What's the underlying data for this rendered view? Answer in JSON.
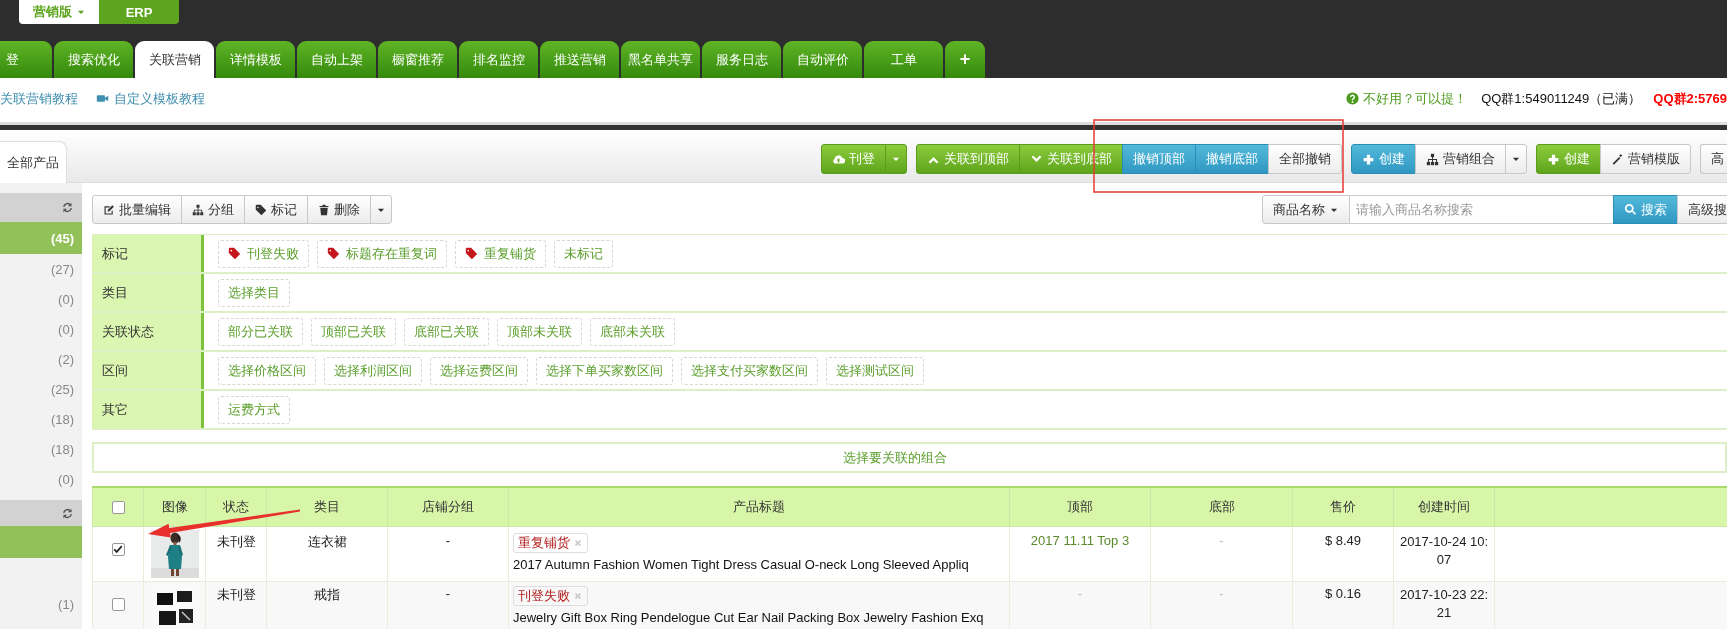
{
  "edition_switch": {
    "items": [
      {
        "label": "营销版",
        "selected": true
      },
      {
        "label": "ERP",
        "selected": false
      }
    ]
  },
  "main_tabs": [
    {
      "label": "登",
      "selected": false,
      "kind": "text"
    },
    {
      "label": "搜索优化",
      "selected": false,
      "kind": "text"
    },
    {
      "label": "关联营销",
      "selected": true,
      "kind": "text"
    },
    {
      "label": "详情模板",
      "selected": false,
      "kind": "text"
    },
    {
      "label": "自动上架",
      "selected": false,
      "kind": "text"
    },
    {
      "label": "橱窗推荐",
      "selected": false,
      "kind": "text"
    },
    {
      "label": "排名监控",
      "selected": false,
      "kind": "text"
    },
    {
      "label": "推送营销",
      "selected": false,
      "kind": "text"
    },
    {
      "label": "黑名单共享",
      "selected": false,
      "kind": "text"
    },
    {
      "label": "服务日志",
      "selected": false,
      "kind": "text"
    },
    {
      "label": "自动评价",
      "selected": false,
      "kind": "text"
    },
    {
      "label": "工单",
      "selected": false,
      "kind": "text"
    },
    {
      "label": "+",
      "selected": false,
      "kind": "add"
    }
  ],
  "links": [
    {
      "label": "关联营销教程",
      "kind": "text"
    },
    {
      "label": "自定义模板教程",
      "kind": "video"
    }
  ],
  "feedback": {
    "prompt": "不好用？可以提！",
    "qq_group_1": "QQ群1:549011249（已满）",
    "qq_group_2": "QQ群2:5769"
  },
  "panel_tab": {
    "label": "全部产品"
  },
  "actions": [
    {
      "buttons": [
        {
          "label": "刊登",
          "kind": "publish"
        },
        {
          "kind": "publish_menu"
        }
      ]
    },
    {
      "buttons": [
        {
          "label": "关联到顶部",
          "kind": "link_top"
        },
        {
          "label": "关联到底部",
          "kind": "link_bottom"
        },
        {
          "label": "撤销顶部",
          "kind": "undo"
        },
        {
          "label": "撤销底部",
          "kind": "undo"
        },
        {
          "label": "全部撤销",
          "kind": "plain"
        }
      ]
    },
    {
      "buttons": [
        {
          "label": "创建",
          "kind": "create_combo"
        },
        {
          "label": "营销组合",
          "kind": "combo"
        },
        {
          "kind": "menu"
        }
      ]
    },
    {
      "buttons": [
        {
          "label": "创建",
          "kind": "create_template"
        },
        {
          "label": "营销模版",
          "kind": "template"
        }
      ]
    },
    {
      "buttons": [
        {
          "label": "高",
          "kind": "plain"
        }
      ]
    }
  ],
  "sidebar": {
    "groups": [
      {
        "items": [
          {
            "count": "(45)",
            "selected": true
          },
          {
            "count": "(27)",
            "selected": false
          },
          {
            "count": "(0)",
            "selected": false
          },
          {
            "count": "(0)",
            "selected": false
          },
          {
            "count": "(2)",
            "selected": false
          },
          {
            "count": "(25)",
            "selected": false
          },
          {
            "count": "(18)",
            "selected": false
          },
          {
            "count": "(18)",
            "selected": false
          },
          {
            "count": "(0)",
            "selected": false
          }
        ]
      },
      {
        "items": [
          {
            "selected": true
          },
          {
            "count": "(1)",
            "selected": false
          }
        ]
      }
    ]
  },
  "batch_actions": [
    {
      "label": "批量编辑",
      "kind": "edit"
    },
    {
      "label": "分组",
      "kind": "group"
    },
    {
      "label": "标记",
      "kind": "mark"
    },
    {
      "label": "删除",
      "kind": "delete"
    },
    {
      "kind": "menu"
    }
  ],
  "search": {
    "field_menu": "商品名称",
    "placeholder": "请输入商品名称搜索",
    "button": "搜索",
    "advanced": "高级搜"
  },
  "filters": [
    {
      "label": "标记",
      "options": [
        {
          "label": "刊登失败",
          "tag": true
        },
        {
          "label": "标题存在重复词",
          "tag": true
        },
        {
          "label": "重复铺货",
          "tag": true
        },
        {
          "label": "未标记",
          "tag": false
        }
      ]
    },
    {
      "label": "类目",
      "options": [
        {
          "label": "选择类目",
          "tag": false
        }
      ]
    },
    {
      "label": "关联状态",
      "options": [
        {
          "label": "部分已关联",
          "tag": false
        },
        {
          "label": "顶部已关联",
          "tag": false
        },
        {
          "label": "底部已关联",
          "tag": false
        },
        {
          "label": "顶部未关联",
          "tag": false
        },
        {
          "label": "底部未关联",
          "tag": false
        }
      ]
    },
    {
      "label": "区间",
      "options": [
        {
          "label": "选择价格区间",
          "tag": false
        },
        {
          "label": "选择利润区间",
          "tag": false
        },
        {
          "label": "选择运费区间",
          "tag": false
        },
        {
          "label": "选择下单买家数区间",
          "tag": false
        },
        {
          "label": "选择支付买家数区间",
          "tag": false
        },
        {
          "label": "选择测试区间",
          "tag": false
        }
      ]
    },
    {
      "label": "其它",
      "options": [
        {
          "label": "运费方式",
          "tag": false
        }
      ]
    }
  ],
  "combo_bar": {
    "prompt": "选择要关联的组合"
  },
  "table": {
    "select_all": {
      "checked": false
    },
    "columns": [
      "图像",
      "状态",
      "类目",
      "店铺分组",
      "产品标题",
      "顶部",
      "底部",
      "售价",
      "创建时间"
    ],
    "rows": [
      {
        "checked": true,
        "image": {
          "kind": "picture"
        },
        "status": "未刊登",
        "category": "连衣裙",
        "shop_group": "-",
        "tags": [
          {
            "label": "重复铺货"
          }
        ],
        "title": "2017 Autumn Fashion Women Tight Dress Casual O-neck Long Sleeved Appliq",
        "top": {
          "text": "2017 11.11 Top 3",
          "linked": true
        },
        "bottom": {
          "text": "-",
          "linked": false
        },
        "price": "$ 8.49",
        "created": "2017-10-24 10:07"
      },
      {
        "checked": false,
        "image": {
          "kind": "picture"
        },
        "status": "未刊登",
        "category": "戒指",
        "shop_group": "-",
        "tags": [
          {
            "label": "刊登失败"
          }
        ],
        "title": "Jewelry Gift Box Ring Pendelogue Cut Ear Nail Packing Box Jewelry Fashion Exq",
        "top": {
          "text": "-",
          "linked": false
        },
        "bottom": {
          "text": "-",
          "linked": false
        },
        "price": "$ 0.16",
        "created": "2017-10-23 22:21"
      }
    ]
  }
}
